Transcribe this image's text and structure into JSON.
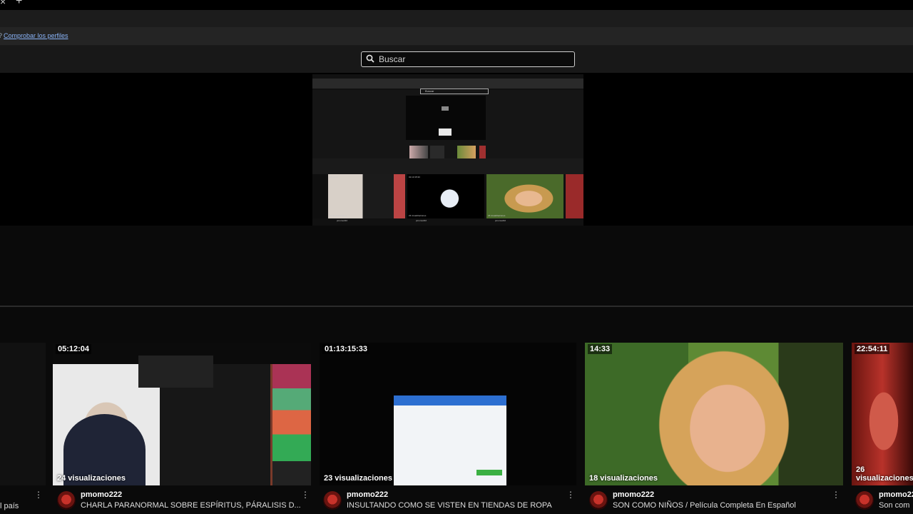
{
  "infobar": {
    "icon": "?",
    "link_text": "Comprobar los perfiles"
  },
  "search": {
    "placeholder": "Buscar"
  },
  "hero": {
    "mini_search": "Buscar",
    "mini_cards": [
      {
        "duration": "05:12:04",
        "views": "24 visualizaciones",
        "channel": "pmomo222"
      },
      {
        "duration": "01:13:15:33",
        "views": "23 visualizaciones",
        "channel": "pmomo222"
      },
      {
        "duration": "14:33",
        "views": "18 visualizaciones",
        "channel": "pmomo222"
      }
    ]
  },
  "left_stub": {
    "text": "l país"
  },
  "cards": [
    {
      "duration": "05:12:04",
      "views": "24 visualizaciones",
      "channel": "pmomo222",
      "title": "CHARLA PARANORMAL SOBRE ESPÍRITUS, PÁRALISIS D..."
    },
    {
      "duration": "01:13:15:33",
      "views": "23 visualizaciones",
      "channel": "pmomo222",
      "title": "INSULTANDO COMO SE VISTEN EN TIENDAS DE ROPA"
    },
    {
      "duration": "14:33",
      "views": "18 visualizaciones",
      "channel": "pmomo222",
      "title": "SON COMO NIÑOS / Película Completa En Español"
    },
    {
      "duration": "22:54:11",
      "views": "26 visualizaciones",
      "channel": "pmomo222",
      "title": "Son com"
    }
  ],
  "colors": {
    "link": "#8ab4f8",
    "background": "#0a0a0a",
    "search_border": "#cfcfcf"
  }
}
